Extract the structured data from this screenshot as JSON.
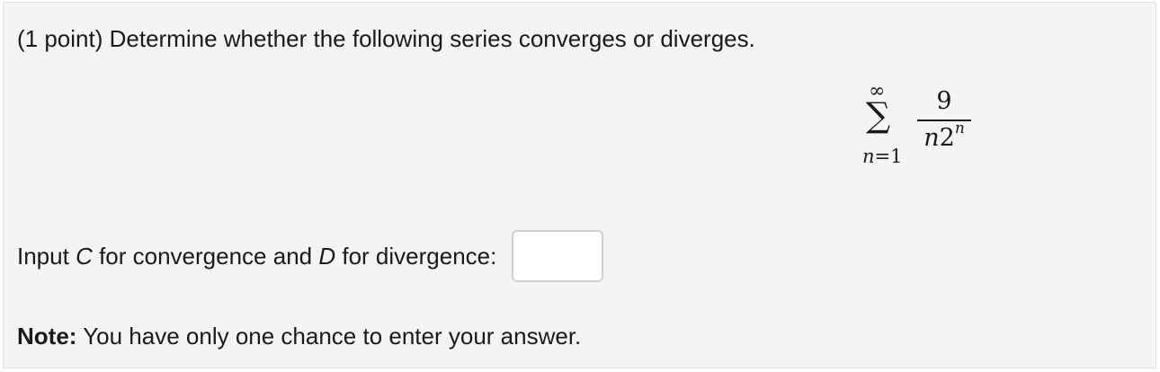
{
  "problem": {
    "question": "(1 point) Determine whether the following series converges or diverges.",
    "series": {
      "upper_limit": "∞",
      "sigma": "∑",
      "index_var": "n",
      "index_eq": "=",
      "lower_start": "1",
      "numerator": "9",
      "denominator_var": "n",
      "denominator_base": "2",
      "denominator_exponent": "n"
    },
    "input_prompt": {
      "part1": "Input ",
      "c_letter": "C",
      "part2": " for convergence and ",
      "d_letter": "D",
      "part3": " for divergence:"
    },
    "answer_input": {
      "value": "",
      "placeholder": ""
    },
    "note": {
      "label": "Note:",
      "text": " You have only one chance to enter your answer."
    }
  }
}
